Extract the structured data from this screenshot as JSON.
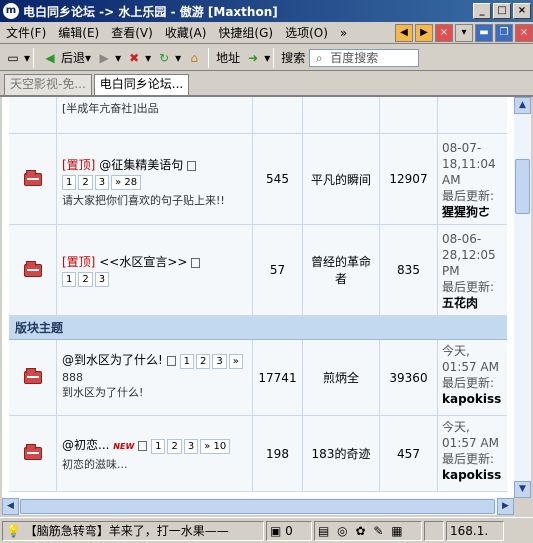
{
  "window": {
    "title": "电白同乡论坛 -> 水上乐园 - 傲游 [Maxthon]",
    "app_icon": "m"
  },
  "menu": {
    "items": [
      "文件(F)",
      "编辑(E)",
      "查看(V)",
      "收藏(A)",
      "快捷组(G)",
      "选项(O)"
    ],
    "more": "»"
  },
  "toolbar": {
    "back_label": "后退",
    "address_label": "地址",
    "search_label": "搜索",
    "search_placeholder": "百度搜索"
  },
  "tabs": [
    {
      "label": "天空影视-免..."
    },
    {
      "label": "电白同乡论坛..."
    }
  ],
  "forum": {
    "partial_row": {
      "sub": "[半成年亢奋社]出品"
    },
    "pinned": [
      {
        "tag": "[置顶]",
        "title": "@征集精美语句",
        "pages": [
          "1",
          "2",
          "3",
          "» 28"
        ],
        "sub": "请大家把你们喜欢的句子贴上来!!",
        "replies": "545",
        "author": "平凡的瞬间",
        "views": "12907",
        "last_time": "08-07-18,11:04 AM",
        "last_label": "最后更新:",
        "last_user": "猩猩狗ㄜ"
      },
      {
        "tag": "[置顶]",
        "title": "<<水区宣言>>",
        "pages": [
          "1",
          "2",
          "3"
        ],
        "sub": "",
        "replies": "57",
        "author": "曾经的革命者",
        "views": "835",
        "last_time": "08-06-28,12:05 PM",
        "last_label": "最后更新:",
        "last_user": "五花肉"
      }
    ],
    "section_title": "版块主题",
    "topics": [
      {
        "title": "@到水区为了什么!",
        "pages": [
          "1",
          "2",
          "3",
          "»"
        ],
        "sub1": "888",
        "sub2": "到水区为了什么!",
        "replies": "17741",
        "author": "煎炳全",
        "views": "39360",
        "last_time": "今天, 01:57 AM",
        "last_label": "最后更新:",
        "last_user": "kapokiss"
      },
      {
        "title": "@初恋...",
        "new_tag": "NEW",
        "pages": [
          "1",
          "2",
          "3",
          "» 10"
        ],
        "sub1": "初恋的滋味...",
        "replies": "198",
        "author": "183的奇迹",
        "views": "457",
        "last_time": "今天, 01:57 AM",
        "last_label": "最后更新:",
        "last_user": "kapokiss"
      }
    ]
  },
  "statusbar": {
    "message": "【脑筋急转弯】羊来了，打一水果——",
    "count": "0",
    "ip": "168.1."
  }
}
